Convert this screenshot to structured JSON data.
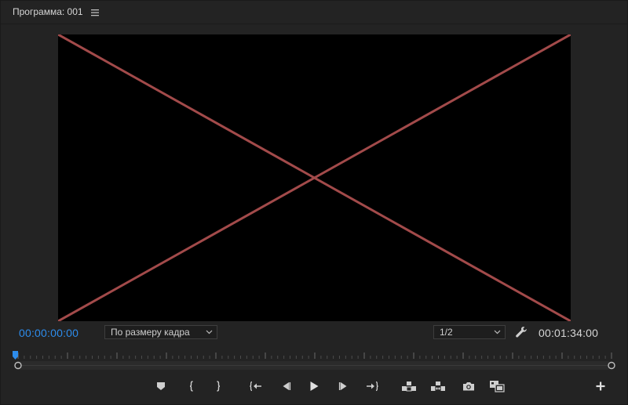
{
  "panel": {
    "title": "Программа: 001"
  },
  "timecodes": {
    "current": "00:00:00:00",
    "duration": "00:01:34:00"
  },
  "zoom_dropdown": {
    "selected": "По размеру кадра"
  },
  "resolution_dropdown": {
    "selected": "1/2"
  },
  "colors": {
    "panel_bg": "#232323",
    "viewer_bg": "#000000",
    "cross": "#a24a4a",
    "accent": "#2d8ceb",
    "icon": "#cfcfcf"
  },
  "icons": {
    "panel_menu": "hamburger-menu-icon",
    "settings": "wrench-icon",
    "marker": "add-marker-icon",
    "mark_in": "mark-in-icon",
    "mark_out": "mark-out-icon",
    "go_to_in": "go-to-in-icon",
    "step_back": "step-back-icon",
    "play": "play-icon",
    "step_forward": "step-forward-icon",
    "go_to_out": "go-to-out-icon",
    "lift": "lift-icon",
    "extract": "extract-icon",
    "export_frame": "camera-icon",
    "compare": "comparison-view-icon",
    "add_button": "plus-icon"
  },
  "playhead_position": 0
}
